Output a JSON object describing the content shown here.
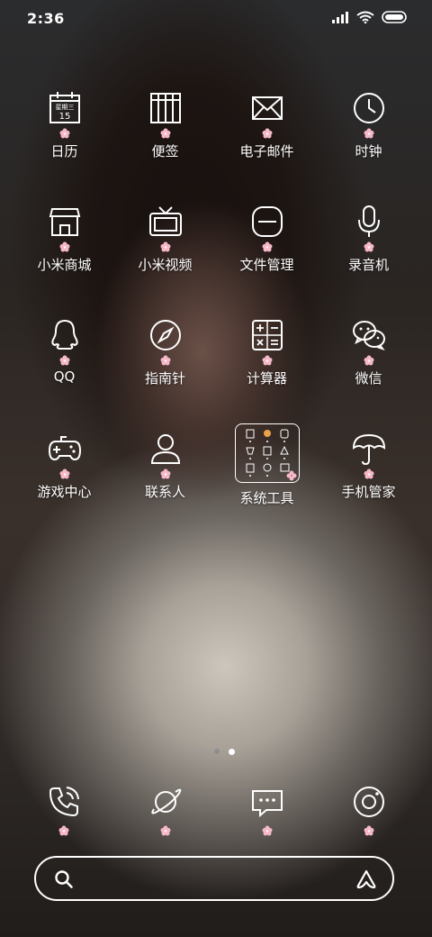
{
  "status_bar": {
    "time": "2:36",
    "icons": [
      "signal-icon",
      "wifi-icon",
      "battery-icon"
    ]
  },
  "calendar": {
    "weekday": "星期三",
    "day": "15"
  },
  "apps": [
    {
      "label": "日历",
      "icon": "calendar-icon"
    },
    {
      "label": "便签",
      "icon": "notes-icon"
    },
    {
      "label": "电子邮件",
      "icon": "mail-icon"
    },
    {
      "label": "时钟",
      "icon": "clock-icon"
    },
    {
      "label": "小米商城",
      "icon": "store-icon"
    },
    {
      "label": "小米视频",
      "icon": "tv-icon"
    },
    {
      "label": "文件管理",
      "icon": "folder-icon"
    },
    {
      "label": "录音机",
      "icon": "microphone-icon"
    },
    {
      "label": "QQ",
      "icon": "qq-penguin-icon"
    },
    {
      "label": "指南针",
      "icon": "compass-icon"
    },
    {
      "label": "计算器",
      "icon": "calculator-icon"
    },
    {
      "label": "微信",
      "icon": "wechat-icon"
    },
    {
      "label": "游戏中心",
      "icon": "gamepad-icon"
    },
    {
      "label": "联系人",
      "icon": "contact-icon"
    },
    {
      "label": "系统工具",
      "icon": "app-folder-icon"
    },
    {
      "label": "手机管家",
      "icon": "umbrella-icon"
    }
  ],
  "page_indicator": {
    "pages": 3,
    "current": 3
  },
  "dock": [
    {
      "icon": "phone-icon"
    },
    {
      "icon": "browser-planet-icon"
    },
    {
      "icon": "messages-icon"
    },
    {
      "icon": "camera-icon"
    }
  ],
  "search_bar": {
    "left_icon": "search-icon",
    "right_icon": "assistant-icon"
  },
  "colors": {
    "icon_stroke": "#ffffff",
    "blossom": "#f6b8c8"
  }
}
